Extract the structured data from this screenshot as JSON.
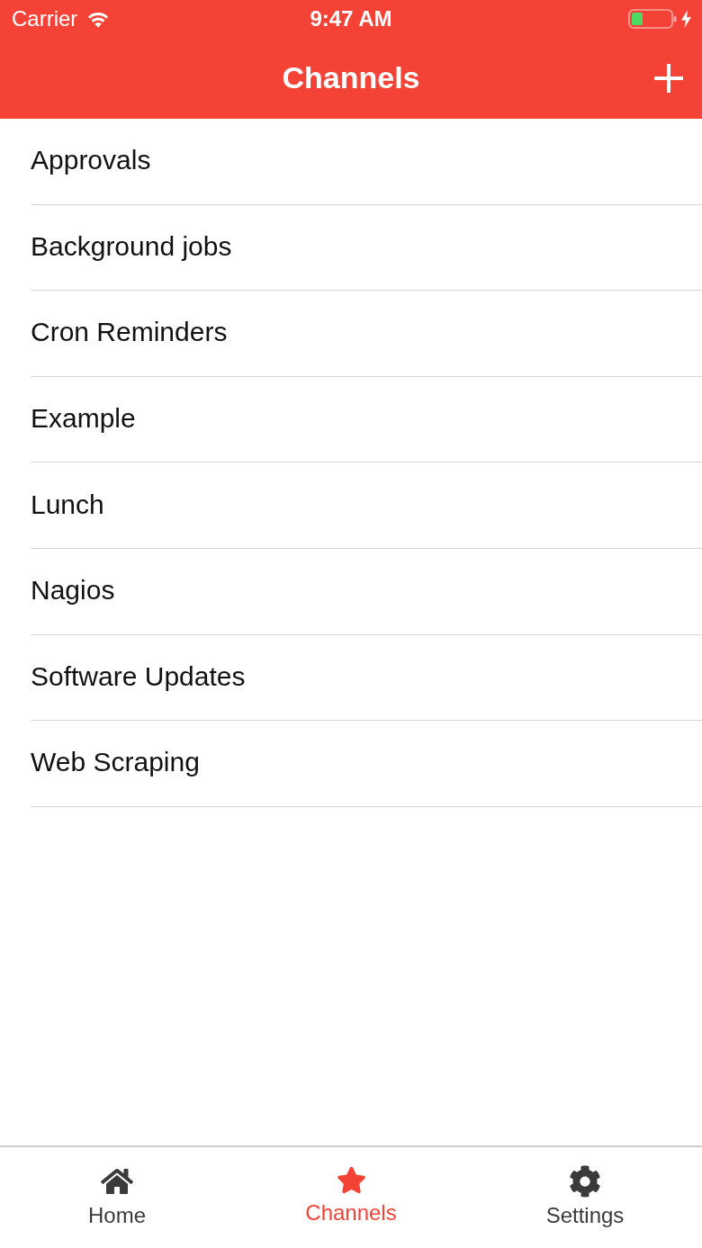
{
  "status_bar": {
    "carrier": "Carrier",
    "time": "9:47 AM"
  },
  "nav_bar": {
    "title": "Channels"
  },
  "channels": [
    {
      "name": "Approvals"
    },
    {
      "name": "Background jobs"
    },
    {
      "name": "Cron Reminders"
    },
    {
      "name": "Example"
    },
    {
      "name": "Lunch"
    },
    {
      "name": "Nagios"
    },
    {
      "name": "Software Updates"
    },
    {
      "name": "Web Scraping"
    }
  ],
  "tab_bar": [
    {
      "label": "Home",
      "selected": false
    },
    {
      "label": "Channels",
      "selected": true
    },
    {
      "label": "Settings",
      "selected": false
    }
  ]
}
